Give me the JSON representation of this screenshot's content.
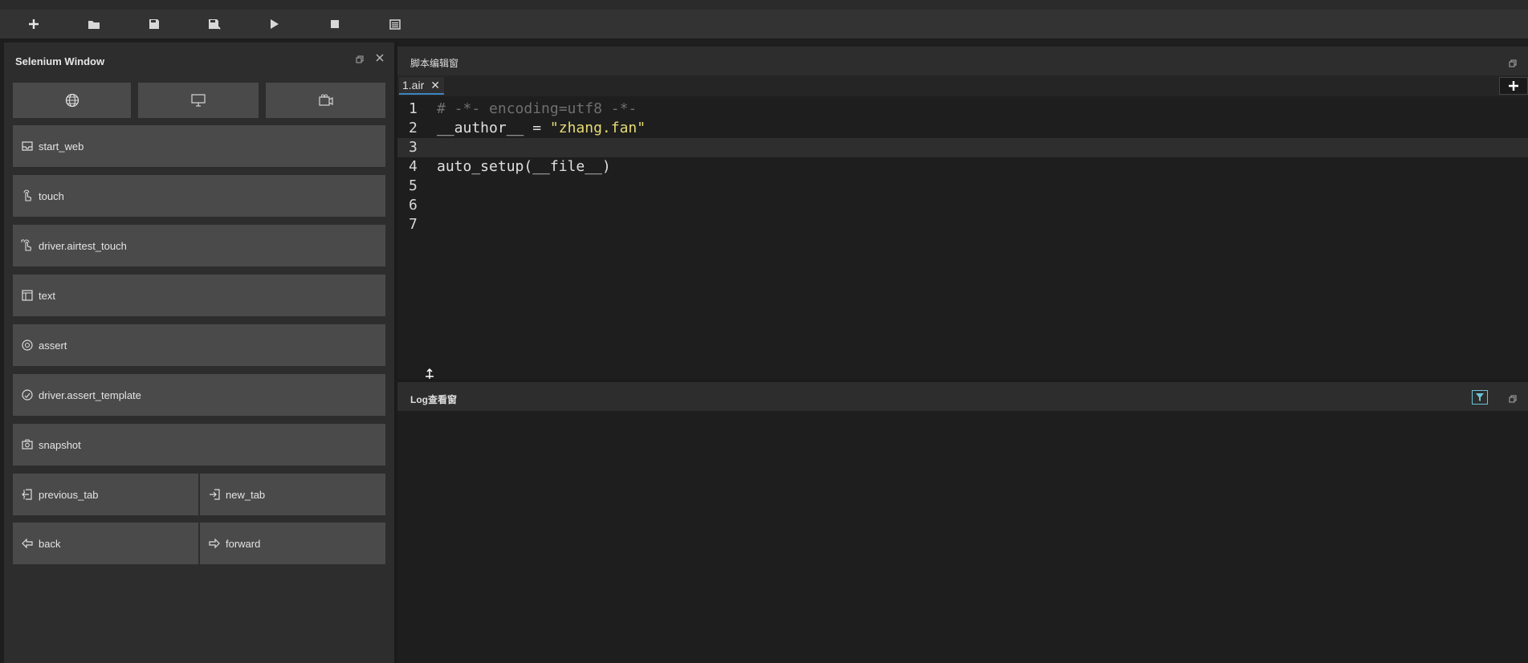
{
  "toolbar": {
    "items": [
      {
        "name": "new-script-button",
        "icon": "plus-icon"
      },
      {
        "name": "open-button",
        "icon": "folder-icon"
      },
      {
        "name": "save-button",
        "icon": "save-icon"
      },
      {
        "name": "save-as-button",
        "icon": "save-as-icon"
      },
      {
        "name": "run-button",
        "icon": "play-icon"
      },
      {
        "name": "stop-button",
        "icon": "stop-icon"
      },
      {
        "name": "log-view-button",
        "icon": "list-icon"
      }
    ]
  },
  "selenium_panel": {
    "title": "Selenium Window",
    "mode_buttons": [
      {
        "icon": "globe-icon"
      },
      {
        "icon": "monitor-icon"
      },
      {
        "icon": "camera-icon"
      }
    ],
    "commands": [
      {
        "label": "start_web",
        "icon": "inbox-icon"
      },
      {
        "label": "touch",
        "icon": "hand-touch-icon"
      },
      {
        "label": "driver.airtest_touch",
        "icon": "hand-touch-icon"
      },
      {
        "label": "text",
        "icon": "text-box-icon"
      },
      {
        "label": "assert",
        "icon": "target-icon"
      },
      {
        "label": "driver.assert_template",
        "icon": "target-icon"
      },
      {
        "label": "snapshot",
        "icon": "camera-icon"
      }
    ],
    "nav_commands": [
      {
        "label": "previous_tab",
        "icon": "tab-prev-icon"
      },
      {
        "label": "new_tab",
        "icon": "tab-new-icon"
      },
      {
        "label": "back",
        "icon": "arrow-left-icon"
      },
      {
        "label": "forward",
        "icon": "arrow-right-icon"
      }
    ]
  },
  "editor": {
    "title": "脚本编辑窗",
    "tab": {
      "label": "1.air",
      "close": "✕"
    },
    "lines": [
      {
        "n": "1",
        "text": "# -*- encoding=utf8 -*-"
      },
      {
        "n": "2",
        "prefix": "__author__ = ",
        "string": "\"zhang.fan\""
      },
      {
        "n": "3",
        "text": ""
      },
      {
        "n": "4",
        "text": "auto_setup(__file__)"
      },
      {
        "n": "5",
        "text": ""
      },
      {
        "n": "6",
        "text": ""
      },
      {
        "n": "7",
        "text": ""
      }
    ]
  },
  "log": {
    "title": "Log查看窗"
  },
  "colors": {
    "background": "#1e1e1e",
    "panel": "#2d2d2d",
    "button": "#4a4a4a",
    "comment": "#6f6f6f",
    "string": "#e6db74",
    "tab_accent": "#3d86c6",
    "filter_accent": "#6bc4d6"
  }
}
